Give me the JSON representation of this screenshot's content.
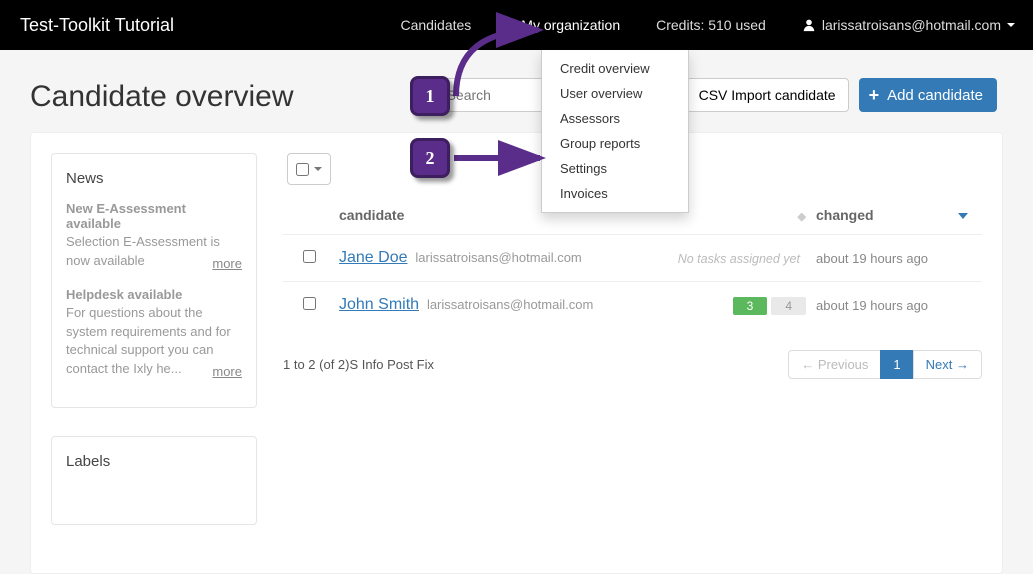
{
  "nav": {
    "brand": "Test-Toolkit Tutorial",
    "candidates": "Candidates",
    "my_org": "My organization",
    "credits": "Credits: 510 used",
    "user": "larissatroisans@hotmail.com"
  },
  "dropdown": {
    "items": [
      "Credit overview",
      "User overview",
      "Assessors",
      "Group reports",
      "Settings",
      "Invoices"
    ]
  },
  "page": {
    "title": "Candidate overview",
    "search_placeholder": "Search",
    "csv_btn": "CSV Import candidate",
    "add_btn": "Add candidate"
  },
  "news": {
    "heading": "News",
    "items": [
      {
        "title": "New E-Assessment available",
        "body": "Selection E-Assessment is now available",
        "more": "more"
      },
      {
        "title": "Helpdesk available",
        "body": "For questions about the system requirements and for technical support you can contact the Ixly he...",
        "more": "more"
      }
    ]
  },
  "labels_panel": {
    "heading": "Labels"
  },
  "table": {
    "col_candidate": "candidate",
    "col_changed": "changed",
    "rows": [
      {
        "name": "Jane Doe",
        "email": "larissatroisans@hotmail.com",
        "tasks_text": "No tasks assigned yet",
        "changed": "about 19 hours ago",
        "badges": null
      },
      {
        "name": "John Smith",
        "email": "larissatroisans@hotmail.com",
        "tasks_text": null,
        "changed": "about 19 hours ago",
        "badges": {
          "done": "3",
          "pending": "4"
        }
      }
    ]
  },
  "footer": {
    "range": "1 to 2 (of 2)",
    "suffix": "S Info Post Fix",
    "prev": "← Previous",
    "page": "1",
    "next": "Next →"
  },
  "callouts": {
    "one": "1",
    "two": "2"
  }
}
